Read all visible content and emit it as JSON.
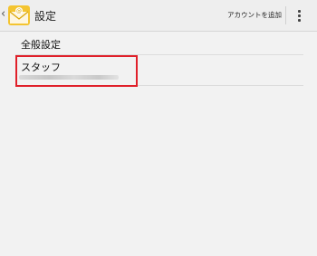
{
  "actionbar": {
    "title": "設定",
    "add_account_label": "アカウントを追加",
    "app_icon": "mail-envelope-icon",
    "overflow_icon": "overflow-menu-icon",
    "back_icon": "chevron-left-icon"
  },
  "settings_list": {
    "items": [
      {
        "label": "全般設定"
      },
      {
        "label": "スタッフ"
      }
    ]
  },
  "colors": {
    "highlight": "#e0202a",
    "icon_yellow": "#f4c430"
  }
}
